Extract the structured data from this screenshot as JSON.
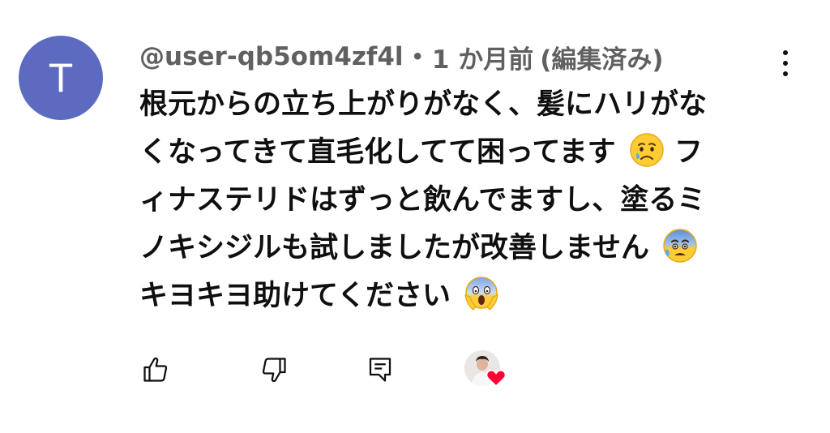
{
  "comment": {
    "avatar_letter": "T",
    "avatar_color": "#5c6bc0",
    "author": "@user-qb5om4zf4l",
    "separator": "•",
    "time": "1 か月前",
    "edited": "(編集済み)",
    "lines": [
      "根元からの立ち上がりがなく、髪にハリがな",
      "くなってきて直毛化してて困ってます",
      "ィナステリドはずっと飲んでますし、塗るミ",
      "ノキシジルも試しましたが改善しません",
      "キヨキヨ助けてください"
    ],
    "line2_tail": "フ",
    "emojis": [
      "crying-face",
      "anxious-face-with-sweat",
      "face-screaming-in-fear"
    ]
  },
  "actions": {
    "icons": [
      "thumbs-up-icon",
      "thumbs-down-icon",
      "reply-icon",
      "creator-heart-icon"
    ],
    "heart_color": "#ff0033"
  }
}
